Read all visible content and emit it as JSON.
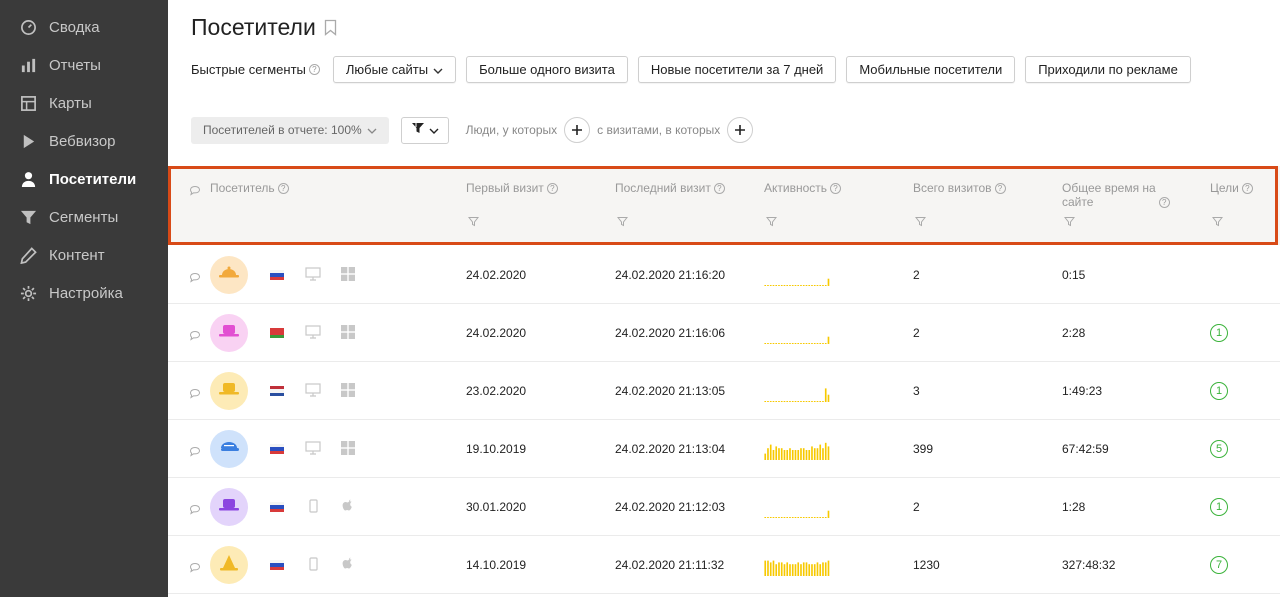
{
  "sidebar": {
    "items": [
      {
        "label": "Сводка",
        "icon": "dashboard-icon",
        "active": false
      },
      {
        "label": "Отчеты",
        "icon": "bar-chart-icon",
        "active": false
      },
      {
        "label": "Карты",
        "icon": "map-icon",
        "active": false
      },
      {
        "label": "Вебвизор",
        "icon": "play-icon",
        "active": false
      },
      {
        "label": "Посетители",
        "icon": "user-icon",
        "active": true
      },
      {
        "label": "Сегменты",
        "icon": "funnel-icon",
        "active": false
      },
      {
        "label": "Контент",
        "icon": "pencil-icon",
        "active": false
      },
      {
        "label": "Настройка",
        "icon": "gear-icon",
        "active": false
      }
    ]
  },
  "page": {
    "title": "Посетители"
  },
  "quick_segments": {
    "label": "Быстрые сегменты",
    "buttons": [
      "Любые сайты",
      "Больше одного визита",
      "Новые посетители за 7 дней",
      "Мобильные посетители",
      "Приходили по рекламе"
    ]
  },
  "filters": {
    "visitors_in_report": "Посетителей в отчете: 100%",
    "people_who": "Люди, у которых",
    "with_visits": "с визитами, в которых"
  },
  "table": {
    "columns": [
      {
        "label": "Посетитель",
        "line2": ""
      },
      {
        "label": "Первый визит",
        "line2": ""
      },
      {
        "label": "Последний визит",
        "line2": ""
      },
      {
        "label": "Активность",
        "line2": ""
      },
      {
        "label": "Всего визитов",
        "line2": ""
      },
      {
        "label": "Общее время на",
        "line2": "сайте"
      },
      {
        "label": "Цели",
        "line2": ""
      }
    ],
    "rows": [
      {
        "avatar_bg": "#fde6c4",
        "hat_color": "#f2a93b",
        "hat": "bowl",
        "flag": "ru",
        "device": "desktop",
        "os": "windows",
        "first_visit": "24.02.2020",
        "last_visit": "24.02.2020 21:16:20",
        "activity": [
          0,
          0,
          0,
          0,
          0,
          0,
          0,
          0,
          0,
          0,
          0,
          0,
          0,
          0,
          0,
          0,
          0,
          0,
          0,
          0,
          0,
          0,
          0,
          0.35
        ],
        "visits": "2",
        "time": "0:15",
        "goals": ""
      },
      {
        "avatar_bg": "#f9d2f3",
        "hat_color": "#e24fd2",
        "hat": "top",
        "flag": "by",
        "device": "desktop",
        "os": "windows",
        "first_visit": "24.02.2020",
        "last_visit": "24.02.2020 21:16:06",
        "activity": [
          0,
          0,
          0,
          0,
          0,
          0,
          0,
          0,
          0,
          0,
          0,
          0,
          0,
          0,
          0,
          0,
          0,
          0,
          0,
          0,
          0,
          0,
          0,
          0.35
        ],
        "visits": "2",
        "time": "2:28",
        "goals": "1"
      },
      {
        "avatar_bg": "#fdebb6",
        "hat_color": "#f0b926",
        "hat": "top",
        "flag": "nl",
        "device": "desktop",
        "os": "windows",
        "first_visit": "23.02.2020",
        "last_visit": "24.02.2020 21:13:05",
        "activity": [
          0,
          0,
          0,
          0,
          0,
          0,
          0,
          0,
          0,
          0,
          0,
          0,
          0,
          0,
          0,
          0,
          0,
          0,
          0,
          0,
          0,
          0,
          0.7,
          0.35
        ],
        "visits": "3",
        "time": "1:49:23",
        "goals": "1"
      },
      {
        "avatar_bg": "#cfe2fb",
        "hat_color": "#3b7fe0",
        "hat": "cap",
        "flag": "ru",
        "device": "desktop",
        "os": "windows",
        "first_visit": "19.10.2019",
        "last_visit": "24.02.2020 21:13:04",
        "activity": [
          0.3,
          0.6,
          0.8,
          0.5,
          0.7,
          0.6,
          0.6,
          0.5,
          0.5,
          0.6,
          0.5,
          0.5,
          0.5,
          0.6,
          0.6,
          0.5,
          0.5,
          0.7,
          0.6,
          0.6,
          0.8,
          0.6,
          0.9,
          0.7
        ],
        "visits": "399",
        "time": "67:42:59",
        "goals": "5"
      },
      {
        "avatar_bg": "#e3d4fb",
        "hat_color": "#8b45e0",
        "hat": "top",
        "flag": "ru",
        "device": "mobile",
        "os": "apple",
        "first_visit": "30.01.2020",
        "last_visit": "24.02.2020 21:12:03",
        "activity": [
          0,
          0,
          0,
          0,
          0,
          0,
          0,
          0,
          0,
          0,
          0,
          0,
          0,
          0,
          0,
          0,
          0,
          0,
          0,
          0,
          0,
          0,
          0,
          0.35
        ],
        "visits": "2",
        "time": "1:28",
        "goals": "1"
      },
      {
        "avatar_bg": "#fdebb6",
        "hat_color": "#f0b926",
        "hat": "cone",
        "flag": "ru",
        "device": "mobile",
        "os": "apple",
        "first_visit": "14.10.2019",
        "last_visit": "24.02.2020 21:11:32",
        "activity": [
          0.8,
          0.8,
          0.7,
          0.8,
          0.6,
          0.7,
          0.7,
          0.6,
          0.7,
          0.6,
          0.6,
          0.6,
          0.7,
          0.6,
          0.7,
          0.7,
          0.6,
          0.6,
          0.6,
          0.7,
          0.6,
          0.7,
          0.7,
          0.8
        ],
        "visits": "1230",
        "time": "327:48:32",
        "goals": "7"
      }
    ]
  },
  "colors": {
    "accent_highlight": "#d84a17",
    "goal_green": "#3bb33b",
    "activity_yellow": "#f7c900",
    "sidebar_bg": "#3a3a3a"
  }
}
